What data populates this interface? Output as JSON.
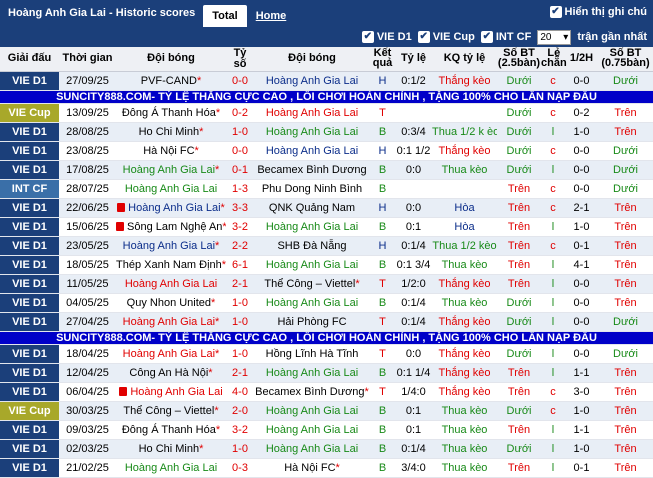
{
  "header": {
    "title": "Hoàng Anh Gia Lai - Historic scores",
    "tab_total": "Total",
    "tab_home": "Home",
    "show_notes": "Hiển thị ghi chú"
  },
  "filters": {
    "f1": "VIE D1",
    "f2": "VIE Cup",
    "f3": "INT CF",
    "select_value": "20",
    "recent_label": "trận gần nhất"
  },
  "columns": [
    "Giải đấu",
    "Thời gian",
    "Đội bóng",
    "Tỷ số",
    "Đội bóng",
    "Kết quả",
    "Tỷ lệ",
    "KQ tỷ lệ",
    "Số BT (2.5bàn)",
    "Lẻ chẵn",
    "1/2H",
    "Số BT (0.75bàn)"
  ],
  "banner": "SUNCITY888.COM- TỶ LỆ THẮNG CỰC CAO , LỐI CHƠI HOÀN CHỈNH , TẶNG 100% CHO LẦN NẠP ĐẦU",
  "colors": {
    "vie_d1": "#1b3f7a",
    "vie_cup": "#a8a82a",
    "int_cf": "#3a6fa8"
  },
  "rows_a": [
    {
      "league": "VIE D1",
      "date": "27/09/25",
      "home": "PVF-CAND",
      "home_star": true,
      "home_cls": "",
      "score": "0-0",
      "away": "Hoàng Anh Gia Lai",
      "away_star": false,
      "away_cls": "blue",
      "res": "H",
      "hcp": "0:1/2",
      "kq": "Thắng kèo",
      "kqc": "red",
      "bt": "Dưới",
      "lc": "c",
      "half": "0-0",
      "bt2": "Dưới"
    }
  ],
  "rows_b": [
    {
      "league": "VIE Cup",
      "date": "13/09/25",
      "home": "Đông Á Thanh Hóa",
      "home_star": true,
      "home_cls": "",
      "score": "0-2",
      "away": "Hoàng Anh Gia Lai",
      "away_star": false,
      "away_cls": "red",
      "res": "T",
      "hcp": "",
      "kq": "",
      "kqc": "",
      "bt": "Dưới",
      "lc": "c",
      "half": "0-2",
      "bt2": "Trên"
    },
    {
      "league": "VIE D1",
      "date": "28/08/25",
      "home": "Ho Chi Minh",
      "home_star": true,
      "home_cls": "",
      "score": "1-0",
      "away": "Hoàng Anh Gia Lai",
      "away_star": false,
      "away_cls": "green",
      "res": "B",
      "hcp": "0:3/4",
      "kq": "Thua 1/2 k èo",
      "kqc": "green",
      "bt": "Dưới",
      "lc": "l",
      "half": "1-0",
      "bt2": "Trên"
    },
    {
      "league": "VIE D1",
      "date": "23/08/25",
      "home": "Hà Nội FC",
      "home_star": true,
      "home_cls": "",
      "score": "0-0",
      "away": "Hoàng Anh Gia Lai",
      "away_star": false,
      "away_cls": "blue",
      "res": "H",
      "hcp": "0:1 1/2",
      "kq": "Thắng kèo",
      "kqc": "red",
      "bt": "Dưới",
      "lc": "c",
      "half": "0-0",
      "bt2": "Dưới"
    },
    {
      "league": "VIE D1",
      "date": "17/08/25",
      "home": "Hoàng Anh Gia Lai",
      "home_star": true,
      "home_cls": "green",
      "score": "0-1",
      "away": "Becamex Bình Dương",
      "away_star": false,
      "away_cls": "",
      "res": "B",
      "hcp": "0:0",
      "kq": "Thua kèo",
      "kqc": "green",
      "bt": "Dưới",
      "lc": "l",
      "half": "0-0",
      "bt2": "Dưới"
    },
    {
      "league": "INT CF",
      "date": "28/07/25",
      "home": "Hoàng Anh Gia Lai",
      "home_star": false,
      "home_cls": "green",
      "score": "1-3",
      "away": "Phu Dong Ninh Bình",
      "away_star": false,
      "away_cls": "",
      "res": "B",
      "hcp": "",
      "kq": "",
      "kqc": "",
      "bt": "Trên",
      "lc": "c",
      "half": "0-0",
      "bt2": "Dưới"
    },
    {
      "league": "VIE D1",
      "date": "22/06/25",
      "home": "Hoàng Anh Gia Lai",
      "home_star": true,
      "home_flag": true,
      "home_cls": "blue",
      "score": "3-3",
      "away": "QNK Quảng Nam",
      "away_star": false,
      "away_cls": "",
      "res": "H",
      "hcp": "0:0",
      "kq": "Hòa",
      "kqc": "blue",
      "bt": "Trên",
      "lc": "c",
      "half": "2-1",
      "bt2": "Trên"
    },
    {
      "league": "VIE D1",
      "date": "15/06/25",
      "home": "Sông Lam Nghệ An",
      "home_star": true,
      "home_flag": true,
      "home_cls": "",
      "score": "3-2",
      "away": "Hoàng Anh Gia Lai",
      "away_star": false,
      "away_cls": "green",
      "res": "B",
      "hcp": "0:1",
      "kq": "Hòa",
      "kqc": "blue",
      "bt": "Trên",
      "lc": "l",
      "half": "1-0",
      "bt2": "Trên"
    },
    {
      "league": "VIE D1",
      "date": "23/05/25",
      "home": "Hoàng Anh Gia Lai",
      "home_star": true,
      "home_cls": "blue",
      "score": "2-2",
      "away": "SHB Đà Nẵng",
      "away_star": false,
      "away_cls": "",
      "res": "H",
      "hcp": "0:1/4",
      "kq": "Thua 1/2 kèo",
      "kqc": "green",
      "bt": "Trên",
      "lc": "c",
      "half": "0-1",
      "bt2": "Trên"
    },
    {
      "league": "VIE D1",
      "date": "18/05/25",
      "home": "Thép Xanh Nam Định",
      "home_star": true,
      "home_cls": "",
      "score": "6-1",
      "away": "Hoàng Anh Gia Lai",
      "away_star": false,
      "away_cls": "green",
      "res": "B",
      "hcp": "0:1 3/4",
      "kq": "Thua kèo",
      "kqc": "green",
      "bt": "Trên",
      "lc": "l",
      "half": "4-1",
      "bt2": "Trên"
    },
    {
      "league": "VIE D1",
      "date": "11/05/25",
      "home": "Hoàng Anh Gia Lai",
      "home_star": false,
      "home_cls": "red",
      "score": "2-1",
      "away": "Thể Công – Viettel",
      "away_star": true,
      "away_cls": "",
      "res": "T",
      "hcp": "1/2:0",
      "kq": "Thắng kèo",
      "kqc": "red",
      "bt": "Trên",
      "lc": "l",
      "half": "0-0",
      "bt2": "Trên"
    },
    {
      "league": "VIE D1",
      "date": "04/05/25",
      "home": "Quy Nhon United",
      "home_star": true,
      "home_cls": "",
      "score": "1-0",
      "away": "Hoàng Anh Gia Lai",
      "away_star": false,
      "away_cls": "green",
      "res": "B",
      "hcp": "0:1/4",
      "kq": "Thua kèo",
      "kqc": "green",
      "bt": "Dưới",
      "lc": "l",
      "half": "0-0",
      "bt2": "Trên"
    },
    {
      "league": "VIE D1",
      "date": "27/04/25",
      "home": "Hoàng Anh Gia Lai",
      "home_star": true,
      "home_cls": "red",
      "score": "1-0",
      "away": "Hải Phòng FC",
      "away_star": false,
      "away_cls": "",
      "res": "T",
      "hcp": "0:1/4",
      "kq": "Thắng kèo",
      "kqc": "red",
      "bt": "Dưới",
      "lc": "l",
      "half": "0-0",
      "bt2": "Dưới"
    }
  ],
  "rows_c": [
    {
      "league": "VIE D1",
      "date": "18/04/25",
      "home": "Hoàng Anh Gia Lai",
      "home_star": true,
      "home_cls": "red",
      "score": "1-0",
      "away": "Hồng Lĩnh Hà Tĩnh",
      "away_star": false,
      "away_cls": "",
      "res": "T",
      "hcp": "0:0",
      "kq": "Thắng kèo",
      "kqc": "red",
      "bt": "Dưới",
      "lc": "l",
      "half": "0-0",
      "bt2": "Dưới"
    },
    {
      "league": "VIE D1",
      "date": "12/04/25",
      "home": "Công An Hà Nội",
      "home_star": true,
      "home_cls": "",
      "score": "2-1",
      "away": "Hoàng Anh Gia Lai",
      "away_star": false,
      "away_cls": "green",
      "res": "B",
      "hcp": "0:1 1/4",
      "kq": "Thắng kèo",
      "kqc": "red",
      "bt": "Trên",
      "lc": "l",
      "half": "1-1",
      "bt2": "Trên"
    },
    {
      "league": "VIE D1",
      "date": "06/04/25",
      "home": "Hoàng Anh Gia Lai",
      "home_star": false,
      "home_flag": true,
      "home_cls": "red",
      "score": "4-0",
      "away": "Becamex Bình Dương",
      "away_star": true,
      "away_cls": "",
      "res": "T",
      "hcp": "1/4:0",
      "kq": "Thắng kèo",
      "kqc": "red",
      "bt": "Trên",
      "lc": "c",
      "half": "3-0",
      "bt2": "Trên"
    },
    {
      "league": "VIE Cup",
      "date": "30/03/25",
      "home": "Thể Công – Viettel",
      "home_star": true,
      "home_cls": "",
      "score": "2-0",
      "away": "Hoàng Anh Gia Lai",
      "away_star": false,
      "away_cls": "green",
      "res": "B",
      "hcp": "0:1",
      "kq": "Thua kèo",
      "kqc": "green",
      "bt": "Dưới",
      "lc": "c",
      "half": "1-0",
      "bt2": "Trên"
    },
    {
      "league": "VIE D1",
      "date": "09/03/25",
      "home": "Đông Á Thanh Hóa",
      "home_star": true,
      "home_cls": "",
      "score": "3-2",
      "away": "Hoàng Anh Gia Lai",
      "away_star": false,
      "away_cls": "green",
      "res": "B",
      "hcp": "0:1",
      "kq": "Thua kèo",
      "kqc": "green",
      "bt": "Trên",
      "lc": "l",
      "half": "1-1",
      "bt2": "Trên"
    },
    {
      "league": "VIE D1",
      "date": "02/03/25",
      "home": "Ho Chi Minh",
      "home_star": true,
      "home_cls": "",
      "score": "1-0",
      "away": "Hoàng Anh Gia Lai",
      "away_star": false,
      "away_cls": "green",
      "res": "B",
      "hcp": "0:1/4",
      "kq": "Thua kèo",
      "kqc": "green",
      "bt": "Dưới",
      "lc": "l",
      "half": "1-0",
      "bt2": "Trên"
    },
    {
      "league": "VIE D1",
      "date": "21/02/25",
      "home": "Hoàng Anh Gia Lai",
      "home_star": false,
      "home_cls": "green",
      "score": "0-3",
      "away": "Hà Nội FC",
      "away_star": true,
      "away_cls": "",
      "res": "B",
      "hcp": "3/4:0",
      "kq": "Thua kèo",
      "kqc": "green",
      "bt": "Trên",
      "lc": "l",
      "half": "0-1",
      "bt2": "Trên"
    }
  ]
}
